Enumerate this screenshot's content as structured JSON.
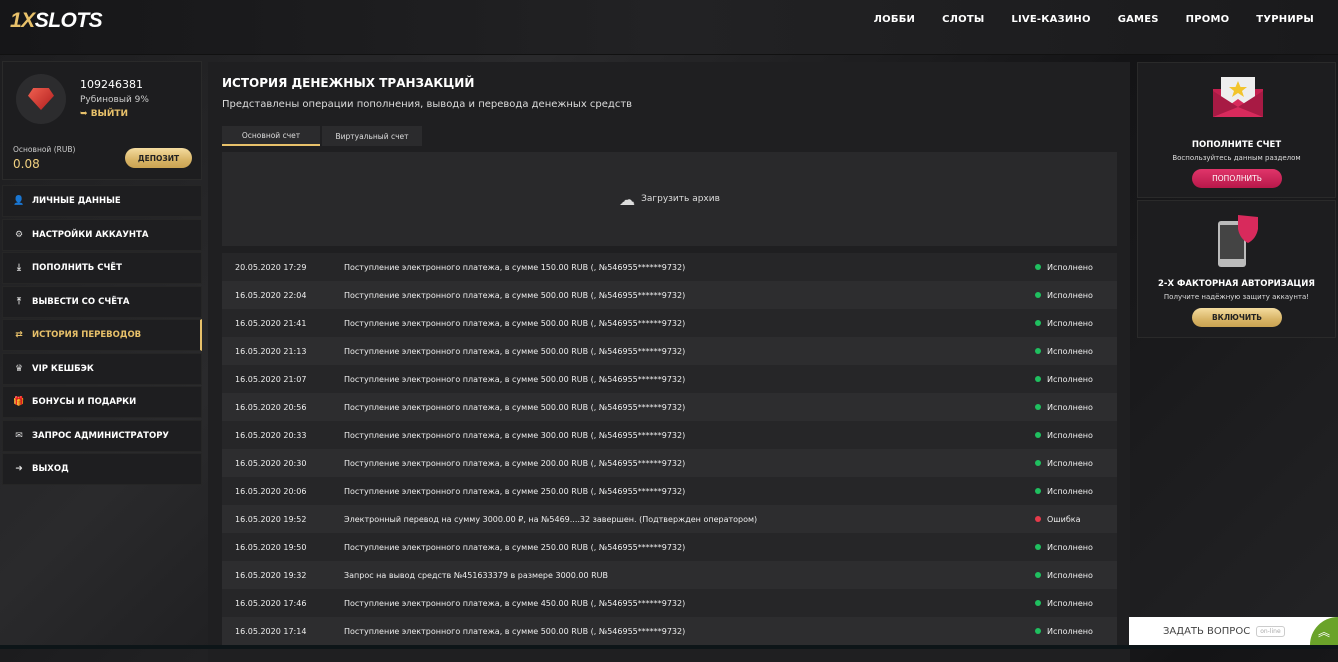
{
  "header": {
    "logo_a": "1X",
    "logo_b": "SLOTS",
    "nav": [
      "ЛОББИ",
      "СЛОТЫ",
      "LIVE-КАЗИНО",
      "GAMES",
      "ПРОМО",
      "ТУРНИРЫ"
    ]
  },
  "profile": {
    "user_id": "109246381",
    "rank": "Рубиновый 9%",
    "logout": "ВЫЙТИ",
    "account_label": "Основной (RUB)",
    "balance": "0.08",
    "deposit": "ДЕПОЗИТ"
  },
  "menu": [
    {
      "icon": "user-icon",
      "glyph": "👤",
      "label": "ЛИЧНЫЕ ДАННЫЕ"
    },
    {
      "icon": "settings-icon",
      "glyph": "⚙",
      "label": "НАСТРОЙКИ АККАУНТА"
    },
    {
      "icon": "deposit-icon",
      "glyph": "⤓",
      "label": "ПОПОЛНИТЬ СЧЁТ"
    },
    {
      "icon": "withdraw-icon",
      "glyph": "⤒",
      "label": "ВЫВЕСТИ СО СЧЁТА"
    },
    {
      "icon": "transfer-icon",
      "glyph": "⇄",
      "label": "ИСТОРИЯ ПЕРЕВОДОВ",
      "active": true
    },
    {
      "icon": "crown-icon",
      "glyph": "♛",
      "label": "VIP КЕШБЭК"
    },
    {
      "icon": "gift-icon",
      "glyph": "🎁",
      "label": "БОНУСЫ И ПОДАРКИ"
    },
    {
      "icon": "mail-icon",
      "glyph": "✉",
      "label": "ЗАПРОС АДМИНИСТРАТОРУ"
    },
    {
      "icon": "exit-icon",
      "glyph": "➜",
      "label": "ВЫХОД"
    }
  ],
  "main": {
    "title": "ИСТОРИЯ ДЕНЕЖНЫХ ТРАНЗАКЦИЙ",
    "subtitle": "Представлены операции пополнения, вывода и перевода денежных средств",
    "tabs": [
      "Основной счет",
      "Виртуальный счет"
    ],
    "upload": "Загрузить архив"
  },
  "transactions": [
    {
      "date": "20.05.2020 17:29",
      "text": "Поступление электронного платежа, в сумме 150.00 RUB (, №546955******9732)",
      "status": "Исполнено",
      "ok": true
    },
    {
      "date": "16.05.2020 22:04",
      "text": "Поступление электронного платежа, в сумме 500.00 RUB (, №546955******9732)",
      "status": "Исполнено",
      "ok": true
    },
    {
      "date": "16.05.2020 21:41",
      "text": "Поступление электронного платежа, в сумме 500.00 RUB (, №546955******9732)",
      "status": "Исполнено",
      "ok": true
    },
    {
      "date": "16.05.2020 21:13",
      "text": "Поступление электронного платежа, в сумме 500.00 RUB (, №546955******9732)",
      "status": "Исполнено",
      "ok": true
    },
    {
      "date": "16.05.2020 21:07",
      "text": "Поступление электронного платежа, в сумме 500.00 RUB (, №546955******9732)",
      "status": "Исполнено",
      "ok": true
    },
    {
      "date": "16.05.2020 20:56",
      "text": "Поступление электронного платежа, в сумме 500.00 RUB (, №546955******9732)",
      "status": "Исполнено",
      "ok": true
    },
    {
      "date": "16.05.2020 20:33",
      "text": "Поступление электронного платежа, в сумме 300.00 RUB (, №546955******9732)",
      "status": "Исполнено",
      "ok": true
    },
    {
      "date": "16.05.2020 20:30",
      "text": "Поступление электронного платежа, в сумме 200.00 RUB (, №546955******9732)",
      "status": "Исполнено",
      "ok": true
    },
    {
      "date": "16.05.2020 20:06",
      "text": "Поступление электронного платежа, в сумме 250.00 RUB (, №546955******9732)",
      "status": "Исполнено",
      "ok": true
    },
    {
      "date": "16.05.2020 19:52",
      "text": "Электронный перевод на сумму 3000.00 ₽, на №5469....32 завершен. (Подтвержден оператором)",
      "status": "Ошибка",
      "ok": false
    },
    {
      "date": "16.05.2020 19:50",
      "text": "Поступление электронного платежа, в сумме 250.00 RUB (, №546955******9732)",
      "status": "Исполнено",
      "ok": true
    },
    {
      "date": "16.05.2020 19:32",
      "text": "Запрос на вывод средств №451633379 в размере 3000.00 RUB",
      "status": "Исполнено",
      "ok": true
    },
    {
      "date": "16.05.2020 17:46",
      "text": "Поступление электронного платежа, в сумме 450.00 RUB (, №546955******9732)",
      "status": "Исполнено",
      "ok": true
    },
    {
      "date": "16.05.2020 17:14",
      "text": "Поступление электронного платежа, в сумме 500.00 RUB (, №546955******9732)",
      "status": "Исполнено",
      "ok": true
    }
  ],
  "promo": {
    "deposit_title": "ПОПОЛНИТЕ СЧЕТ",
    "deposit_text": "Воспользуйтесь данным разделом",
    "deposit_btn": "ПОПОЛНИТЬ",
    "twofa_title": "2-Х ФАКТОРНАЯ АВТОРИЗАЦИЯ",
    "twofa_text": "Получите надёжную защиту аккаунта!",
    "twofa_btn": "ВКЛЮЧИТЬ"
  },
  "chat": {
    "label": "ЗАДАТЬ ВОПРОС",
    "status": "on-line",
    "up": "︽"
  }
}
